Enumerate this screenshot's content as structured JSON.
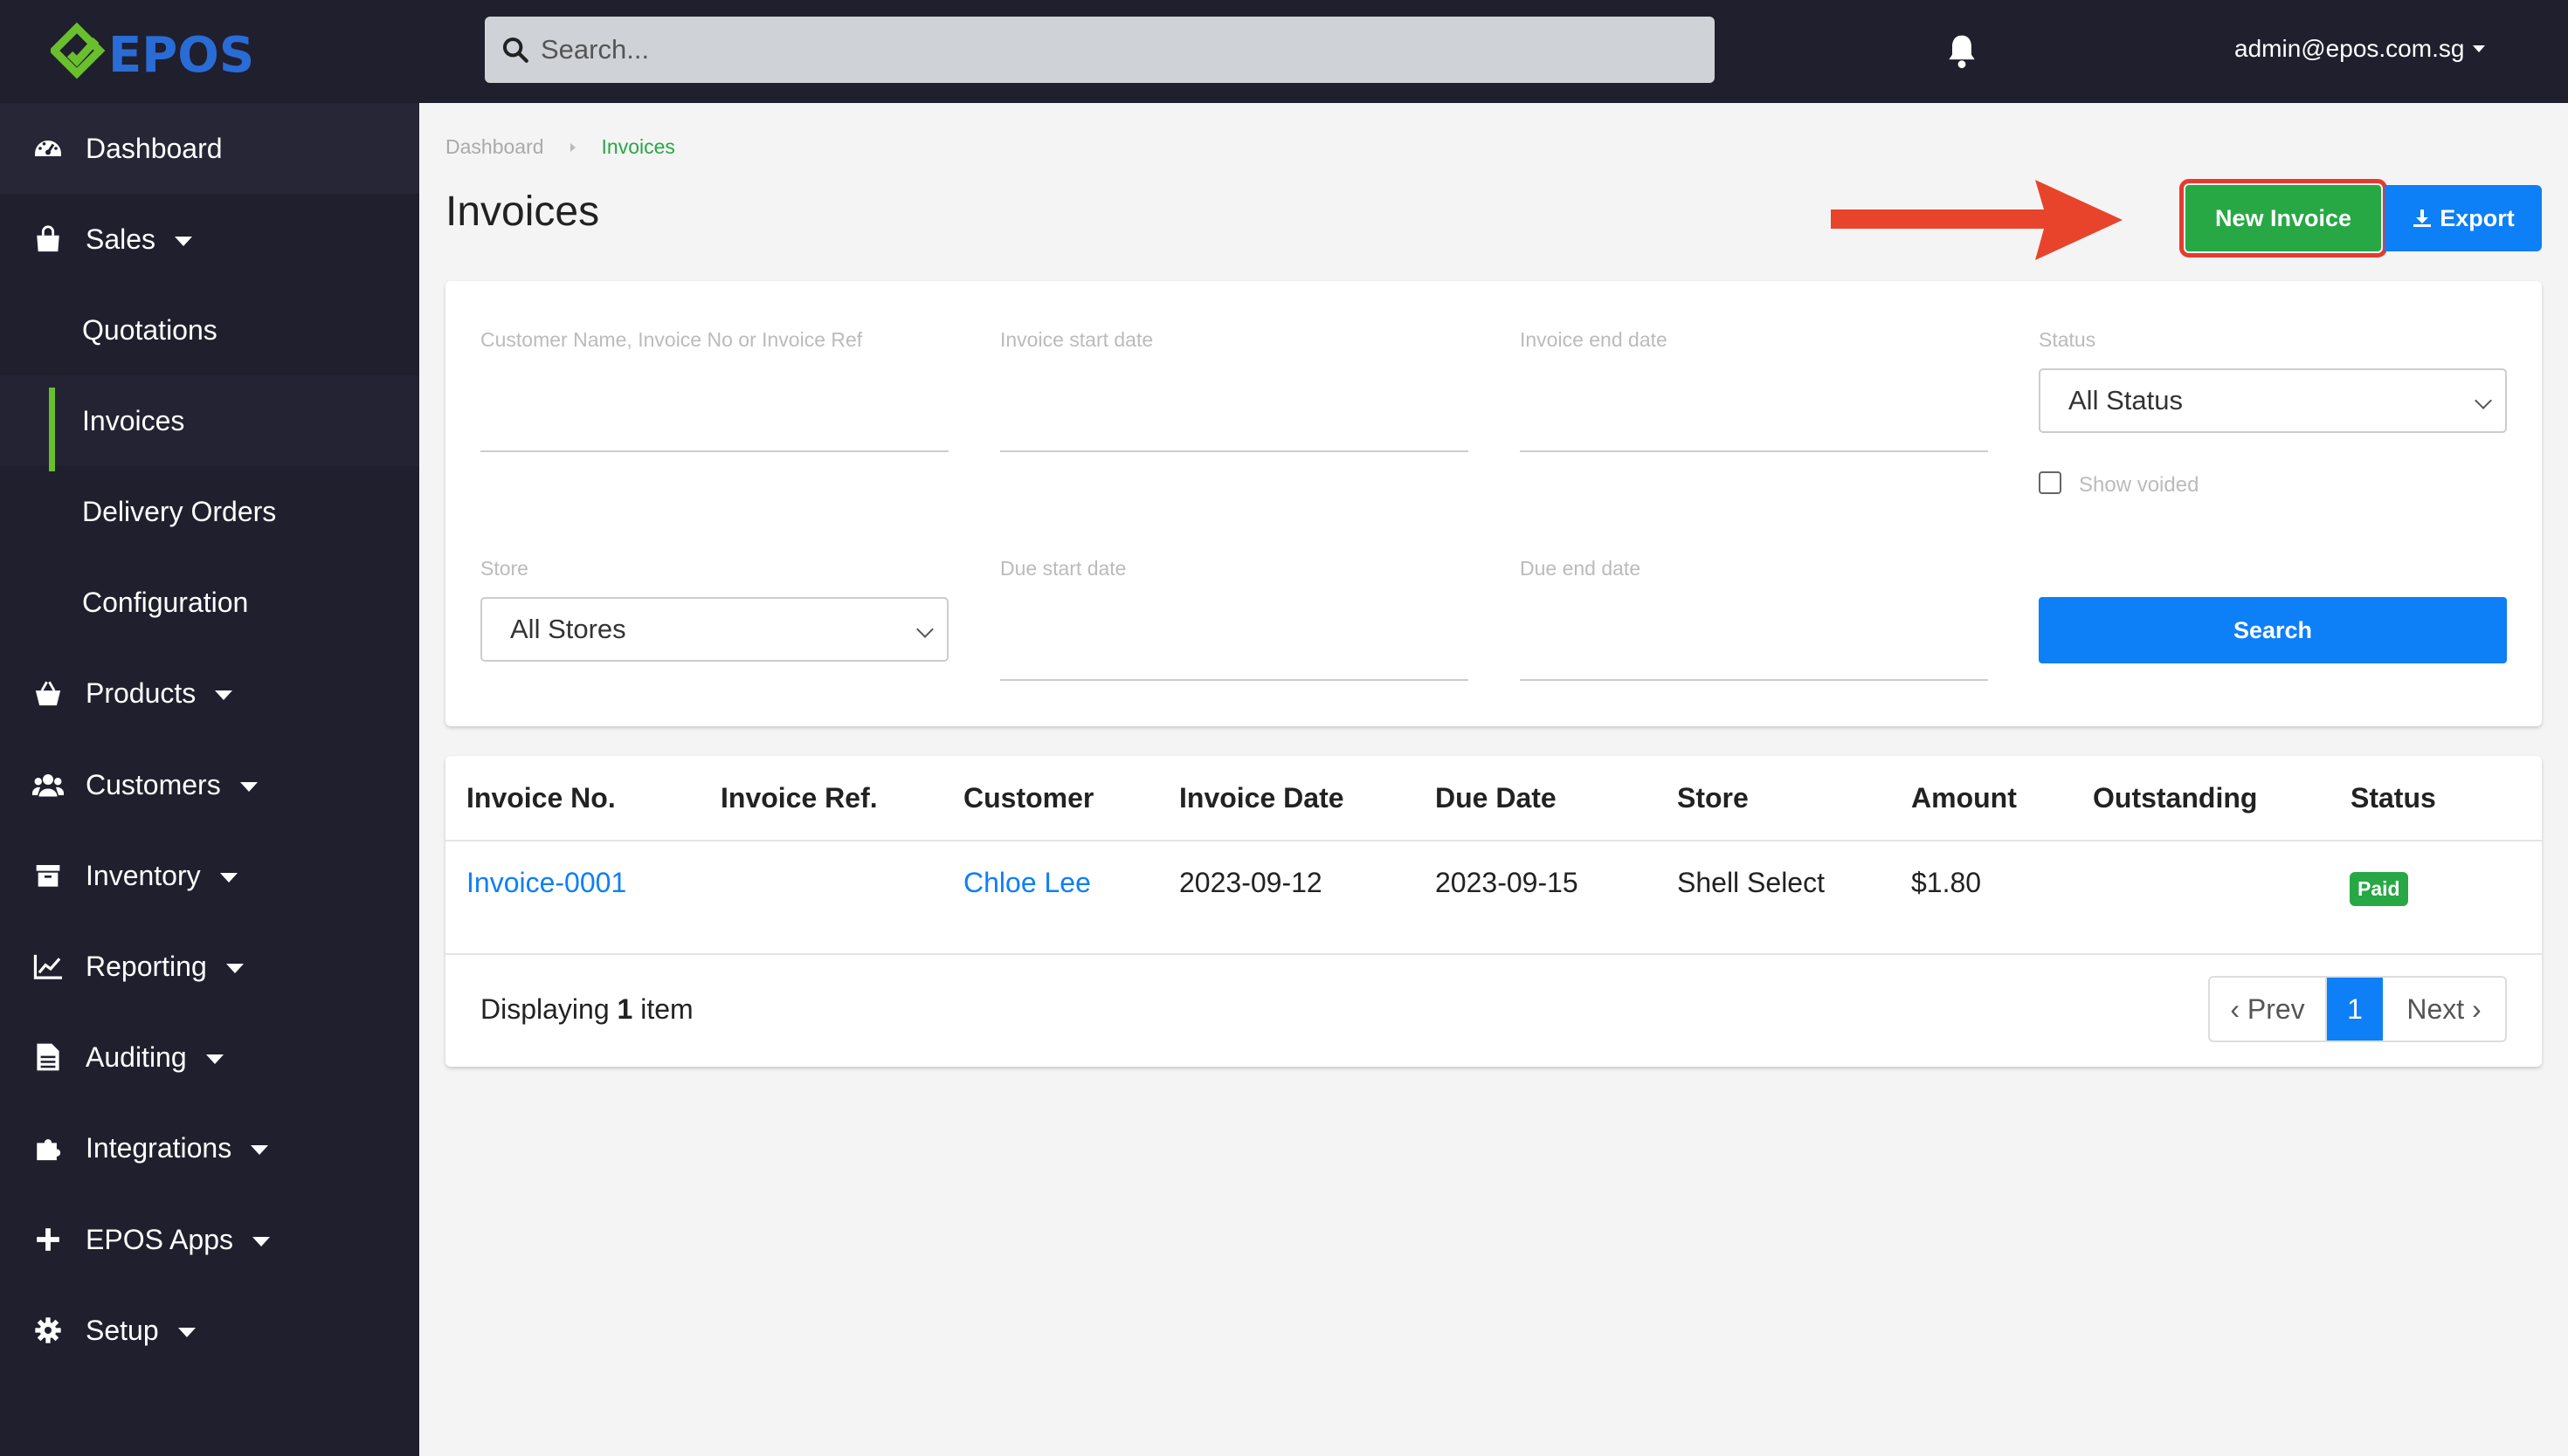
{
  "app": {
    "logo_text": "EPOS",
    "brand_green": "#6abf2c",
    "brand_blue": "#2a6cd6"
  },
  "topbar": {
    "search_placeholder": "Search...",
    "user_email": "admin@epos.com.sg"
  },
  "sidebar": {
    "items": [
      {
        "label": "Dashboard",
        "icon": "tachometer-icon"
      },
      {
        "label": "Sales",
        "icon": "shopping-bag-icon"
      },
      {
        "label": "Products",
        "icon": "shopping-basket-icon"
      },
      {
        "label": "Customers",
        "icon": "users-icon"
      },
      {
        "label": "Inventory",
        "icon": "archive-box-icon"
      },
      {
        "label": "Reporting",
        "icon": "line-chart-icon"
      },
      {
        "label": "Auditing",
        "icon": "file-text-icon"
      },
      {
        "label": "Integrations",
        "icon": "puzzle-piece-icon"
      },
      {
        "label": "EPOS Apps",
        "icon": "plus-icon"
      },
      {
        "label": "Setup",
        "icon": "gear-icon"
      }
    ],
    "sales_sub": [
      "Quotations",
      "Invoices",
      "Delivery Orders",
      "Configuration"
    ],
    "active_sub": "Invoices"
  },
  "breadcrumb": {
    "home": "Dashboard",
    "current": "Invoices"
  },
  "page": {
    "title": "Invoices",
    "new_invoice": "New Invoice",
    "export": "Export"
  },
  "filters": {
    "customer_label": "Customer Name, Invoice No or Invoice Ref",
    "inv_start_label": "Invoice start date",
    "inv_end_label": "Invoice end date",
    "status_label": "Status",
    "status_value": "All Status",
    "show_voided": "Show voided",
    "store_label": "Store",
    "store_value": "All Stores",
    "due_start_label": "Due start date",
    "due_end_label": "Due end date",
    "search_button": "Search"
  },
  "table": {
    "columns": [
      "Invoice No.",
      "Invoice Ref.",
      "Customer",
      "Invoice Date",
      "Due Date",
      "Store",
      "Amount",
      "Outstanding",
      "Status"
    ],
    "rows": [
      {
        "invoice_no": "Invoice-0001",
        "invoice_ref": "",
        "customer": "Chloe Lee",
        "invoice_date": "2023-09-12",
        "due_date": "2023-09-15",
        "store": "Shell Select",
        "amount": "$1.80",
        "outstanding": "",
        "status": "Paid"
      }
    ],
    "footer_prefix": "Displaying",
    "footer_count": "1",
    "footer_suffix": "item",
    "pager": {
      "prev": "‹ Prev",
      "page": "1",
      "next": "Next ›"
    }
  },
  "annotation": {
    "arrow_color": "#e8442b"
  }
}
